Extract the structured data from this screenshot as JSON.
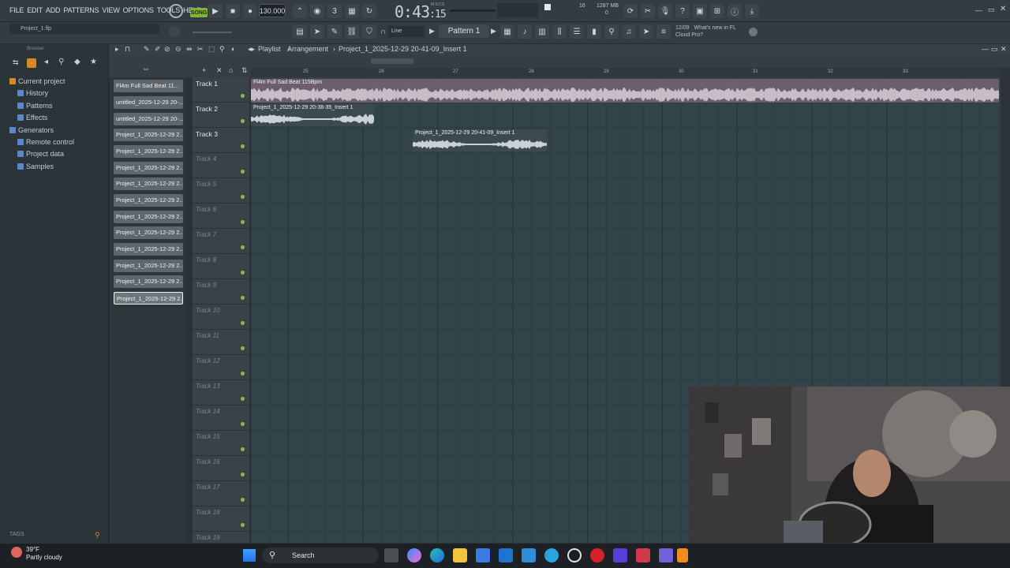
{
  "menu": [
    "FILE",
    "EDIT",
    "ADD",
    "PATTERNS",
    "VIEW",
    "OPTIONS",
    "TOOLS",
    "HELP"
  ],
  "transport": {
    "mode_label": "SONG",
    "tempo": "130.000",
    "time_main": "0:43",
    "time_small": ":15",
    "time_unit_label": "M:S:CS",
    "cpu_value": "16",
    "ram_value": "1287 MB",
    "poly_value": "0"
  },
  "project_file": "Project_1.flp",
  "snap_mode": "Line",
  "pattern_selector": "Pattern 1",
  "news": {
    "date": "12/09",
    "line1": "What's new in FL",
    "line2": "Cloud Pro?"
  },
  "browser": {
    "header": "Browser",
    "items": [
      {
        "label": "Current project",
        "color": "#d88a2a",
        "top": true
      },
      {
        "label": "History",
        "color": "#5a88c9"
      },
      {
        "label": "Patterns",
        "color": "#5a88c9"
      },
      {
        "label": "Effects",
        "color": "#5a88c9"
      },
      {
        "label": "Generators",
        "color": "#5a88c9",
        "top": true
      },
      {
        "label": "Remote control",
        "color": "#5a88c9"
      },
      {
        "label": "Project data",
        "color": "#5a88c9"
      },
      {
        "label": "Samples",
        "color": "#5a88c9"
      }
    ],
    "tags_label": "TAGS"
  },
  "channels": [
    "Fl4m Full Sad Beat 11...",
    "untitled_2025-12-29 20-...",
    "untitled_2025-12-29 20-...",
    "Project_1_2025-12-29 2...",
    "Project_1_2025-12-29 2...",
    "Project_1_2025-12-29 2...",
    "Project_1_2025-12-29 2...",
    "Project_1_2025-12-29 2...",
    "Project_1_2025-12-29 2...",
    "Project_1_2025-12-29 2...",
    "Project_1_2025-12-29 2...",
    "Project_1_2025-12-29 2...",
    "Project_1_2025-12-29 2...",
    "Project_1_2025-12-29 2..."
  ],
  "playlist": {
    "title": "Playlist",
    "arrangement": "Arrangement",
    "selected_clip": "Project_1_2025-12-29 20-41-09_Insert 1",
    "ruler_marks": [
      "25",
      "26",
      "27",
      "28",
      "29",
      "30",
      "31",
      "32",
      "33"
    ],
    "tracks": [
      "Track 1",
      "Track 2",
      "Track 3",
      "Track 4",
      "Track 5",
      "Track 6",
      "Track 7",
      "Track 8",
      "Track 9",
      "Track 10",
      "Track 11",
      "Track 12",
      "Track 13",
      "Track 14",
      "Track 15",
      "Track 16",
      "Track 17",
      "Track 18",
      "Track 19"
    ],
    "clips": [
      {
        "name": "Fl4m Full Sad Beat 115Bpm",
        "track": 0
      },
      {
        "name": "Project_1_2025-12-29 20-38-35_Insert 1",
        "track": 1
      },
      {
        "name": "Project_1_2025-12-29 20-41-09_Insert 1",
        "track": 2
      }
    ]
  },
  "taskbar": {
    "temperature": "39°F",
    "weather": "Partly cloudy",
    "search_label": "Search"
  }
}
